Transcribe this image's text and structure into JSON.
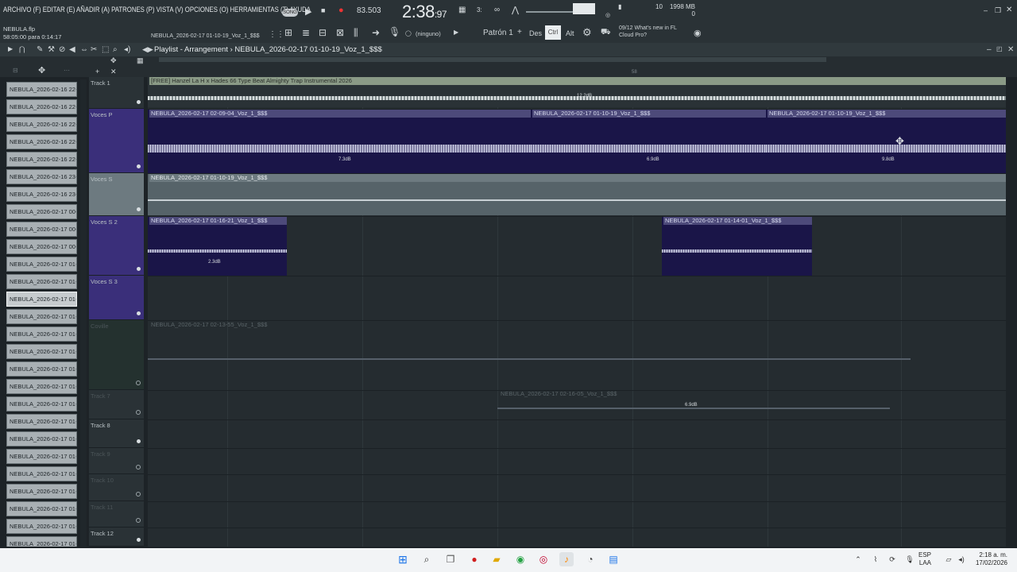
{
  "menubar": {
    "menus": "ARCHIVO (F) EDITAR (E) AÑADIR (A) PATRONES (P) VISTA (V) OPCIONES (O) HERRAMIENTAS (T) AYUDA",
    "song_badge": "SONG",
    "tempo": "83.503",
    "time_main": "2:38",
    "time_sub": ":97",
    "cpu_ram": "10",
    "ram": "1998 MB",
    "cpu_zero": "0",
    "hint_count": "09/12",
    "hint_text": "What's new in FL Cloud Pro?"
  },
  "fileinfo": {
    "project": "NEBULA.flp",
    "position": "58:05:00 para 0:14:17",
    "current_clip": "NEBULA_2026-02-17 01-10-19_Voz_1_$$$"
  },
  "toolbar": {
    "none_label": "(ninguno)",
    "pattern": "Patrón 1",
    "snap_label": "Des",
    "snap_btn": "Ctrl",
    "alt_label": "Alt"
  },
  "playlist": {
    "title": "Playlist - Arrangement",
    "arrangement": "NEBULA_2026-02-17 01-10-19_Voz_1_$$$",
    "ruler_mark": "58"
  },
  "picker": [
    "NEBULA_2026-02-16 22-...",
    "NEBULA_2026-02-16 22-...",
    "NEBULA_2026-02-16 22-...",
    "NEBULA_2026-02-16 22-...",
    "NEBULA_2026-02-16 22-...",
    "NEBULA_2026-02-16 23-...",
    "NEBULA_2026-02-16 23-...",
    "NEBULA_2026-02-17 00-...",
    "NEBULA_2026-02-17 00-...",
    "NEBULA_2026-02-17 00-...",
    "NEBULA_2026-02-17 01-...",
    "NEBULA_2026-02-17 01-...",
    "NEBULA_2026-02-17 01-...",
    "NEBULA_2026-02-17 01-...",
    "NEBULA_2026-02-17 01-...",
    "NEBULA_2026-02-17 01-...",
    "NEBULA_2026-02-17 01-...",
    "NEBULA_2026-02-17 01-...",
    "NEBULA_2026-02-17 01-...",
    "NEBULA_2026-02-17 01-...",
    "NEBULA_2026-02-17 01-...",
    "NEBULA_2026-02-17 01-...",
    "NEBULA_2026-02-17 01-...",
    "NEBULA_2026-02-17 01-...",
    "NEBULA_2026-02-17 01-...",
    "NEBULA_2026-02-17 01-...",
    "NEBULA_2026-02-17 01-..."
  ],
  "tracks": [
    {
      "name": "Track 1",
      "active": true
    },
    {
      "name": "Voces P",
      "active": true
    },
    {
      "name": "Voces S",
      "active": true
    },
    {
      "name": "Voces S 2",
      "active": true
    },
    {
      "name": "Voces S 3",
      "active": true
    },
    {
      "name": "Coville",
      "active": false
    },
    {
      "name": "Track 7",
      "active": false
    },
    {
      "name": "Track 8",
      "active": true
    },
    {
      "name": "Track 9",
      "active": false
    },
    {
      "name": "Track 10",
      "active": false
    },
    {
      "name": "Track 11",
      "active": false
    },
    {
      "name": "Track 12",
      "active": true
    }
  ],
  "clips": [
    {
      "label": "[FREE] Hanzel La H x Hades 66 Type Beat Almighty  Trap Instrumental 2026",
      "db": "12.2dB",
      "kind": "beat"
    },
    {
      "label": "NEBULA_2026-02-17 02-09-04_Voz_1_$$$",
      "db": "7.3dB",
      "kind": "vocal"
    },
    {
      "label": "NEBULA_2026-02-17 01-10-19_Voz_1_$$$",
      "db": "6.9dB",
      "kind": "vocal"
    },
    {
      "label": "NEBULA_2026-02-17 01-10-19_Voz_1_$$$",
      "db": "9.8dB",
      "kind": "vocal"
    },
    {
      "label": "NEBULA_2026-02-17 01-10-19_Voz_1_$$$",
      "db": "",
      "kind": "selected"
    },
    {
      "label": "NEBULA_2026-02-17 01-16-21_Voz_1_$$$",
      "db": "2.3dB",
      "kind": "vocal"
    },
    {
      "label": "NEBULA_2026-02-17 01-14-01_Voz_1_$$$",
      "db": "",
      "kind": "vocal"
    },
    {
      "label": "NEBULA_2026-02-17 02-13-55_Voz_1_$$$",
      "db": "",
      "kind": "muted"
    },
    {
      "label": "NEBULA_2026-02-17 02-16-05_Voz_1_$$$",
      "db": "6.9dB",
      "kind": "muted"
    }
  ],
  "taskbar": {
    "lang": "ESP",
    "region": "LAA",
    "clock": "2:18 a. m.",
    "date": "17/02/2026"
  },
  "colors": {
    "vocal_track": "#3a2f7a",
    "clip_body": "#1a1548",
    "clip_header": "#4d4a7a",
    "beat_header": "#8a9a86",
    "selected_track": "#6d7a80"
  }
}
